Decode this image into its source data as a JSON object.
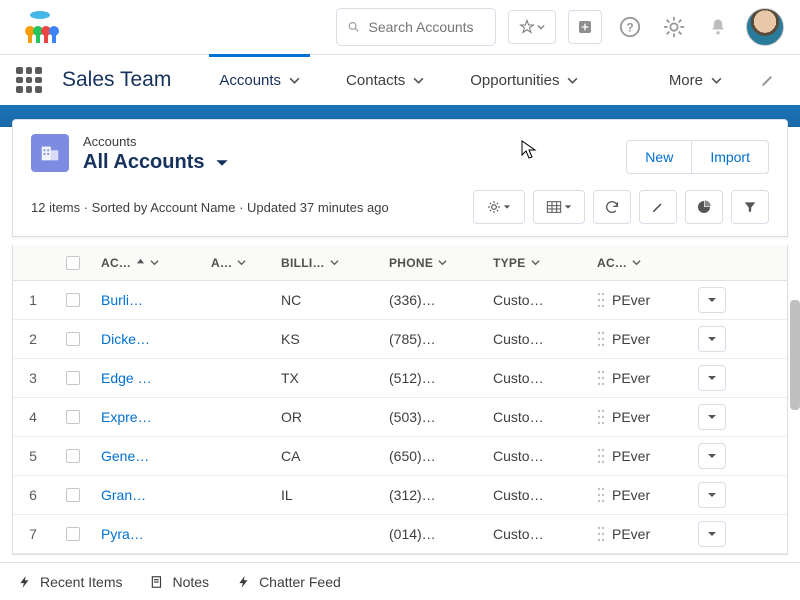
{
  "header": {
    "search_placeholder": "Search Accounts"
  },
  "nav": {
    "app_name": "Sales Team",
    "items": [
      "Accounts",
      "Contacts",
      "Opportunities",
      "More"
    ],
    "active_index": 0
  },
  "page": {
    "object_label": "Accounts",
    "view_name": "All Accounts",
    "meta": "12 items · Sorted by Account Name · Updated 37 minutes ago",
    "actions": {
      "new": "New",
      "import": "Import"
    }
  },
  "columns": {
    "name": "ACCOUNT NAME",
    "site": "ACCOUNT SITE",
    "state": "BILLING STATE",
    "phone": "PHONE",
    "type": "TYPE",
    "owner": "ACCOUNT OWNER"
  },
  "columns_display": {
    "name": "AC…",
    "site": "A…",
    "state": "BILLI…",
    "phone": "PHONE",
    "type": "TYPE",
    "owner": "AC…"
  },
  "rows": [
    {
      "num": 1,
      "name": "Burli…",
      "site": "",
      "state": "NC",
      "phone": "(336)…",
      "type": "Custo…",
      "owner": "PEver"
    },
    {
      "num": 2,
      "name": "Dicke…",
      "site": "",
      "state": "KS",
      "phone": "(785)…",
      "type": "Custo…",
      "owner": "PEver"
    },
    {
      "num": 3,
      "name": "Edge …",
      "site": "",
      "state": "TX",
      "phone": "(512)…",
      "type": "Custo…",
      "owner": "PEver"
    },
    {
      "num": 4,
      "name": "Expre…",
      "site": "",
      "state": "OR",
      "phone": "(503)…",
      "type": "Custo…",
      "owner": "PEver"
    },
    {
      "num": 5,
      "name": "Gene…",
      "site": "",
      "state": "CA",
      "phone": "(650)…",
      "type": "Custo…",
      "owner": "PEver"
    },
    {
      "num": 6,
      "name": "Gran…",
      "site": "",
      "state": "IL",
      "phone": "(312)…",
      "type": "Custo…",
      "owner": "PEver"
    },
    {
      "num": 7,
      "name": "Pyra…",
      "site": "",
      "state": "",
      "phone": "(014)…",
      "type": "Custo…",
      "owner": "PEver"
    }
  ],
  "footer": {
    "recent": "Recent Items",
    "notes": "Notes",
    "chatter": "Chatter Feed"
  }
}
